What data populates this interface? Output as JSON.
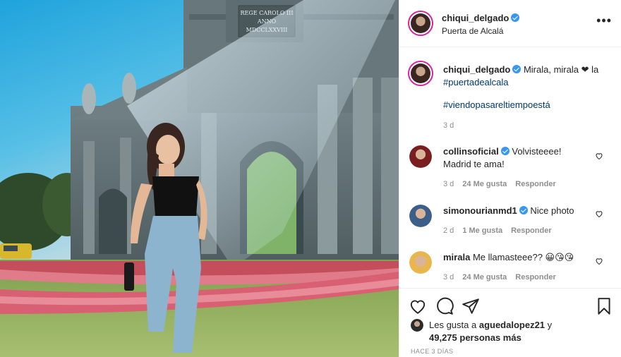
{
  "post": {
    "username": "chiqui_delgado",
    "location": "Puerta de Alcalá",
    "more_label": "•••"
  },
  "photo": {
    "inscription_lines": [
      "REGE CAROLO III",
      "ANNO",
      "MDCCLXXVIII"
    ]
  },
  "caption": {
    "username": "chiqui_delgado",
    "text_before": "Mirala, mirala",
    "heart": "❤",
    "text_after": "la",
    "hashtag1": "#puertadealcala",
    "hashtag2": "#viendopasareltiempoestá",
    "time": "3 d"
  },
  "comments": [
    {
      "username": "collinsoficial",
      "verified": true,
      "text_line1": "Volvisteeee!",
      "text_line2": "Madrid te ama!",
      "time": "3 d",
      "likes": "24 Me gusta",
      "reply": "Responder",
      "avatar_color": "#7a1f1f"
    },
    {
      "username": "simonourianmd1",
      "verified": true,
      "text_line1": "Nice photo",
      "text_line2": "",
      "time": "2 d",
      "likes": "1 Me gusta",
      "reply": "Responder",
      "avatar_color": "#3c5f8a"
    },
    {
      "username": "mirala",
      "verified": false,
      "text_line1": "Me llamasteee?? 😀😘😘",
      "text_line2": "",
      "time": "3 d",
      "likes": "24 Me gusta",
      "reply": "Responder",
      "avatar_color": "#e8b64c"
    }
  ],
  "likes": {
    "prefix": "Les gusta a",
    "user": "aguedalopez21",
    "mid": "y",
    "count": "49,275 personas más"
  },
  "timestamp": "HACE 3 DÍAS",
  "icons": [
    "more-icon",
    "heart-icon",
    "comment-icon",
    "share-icon",
    "bookmark-icon"
  ],
  "colors": {
    "verified": "#3897f0",
    "hashtag": "#00376b",
    "story_ring": "#d6249f",
    "muted": "#8e8e8e"
  }
}
